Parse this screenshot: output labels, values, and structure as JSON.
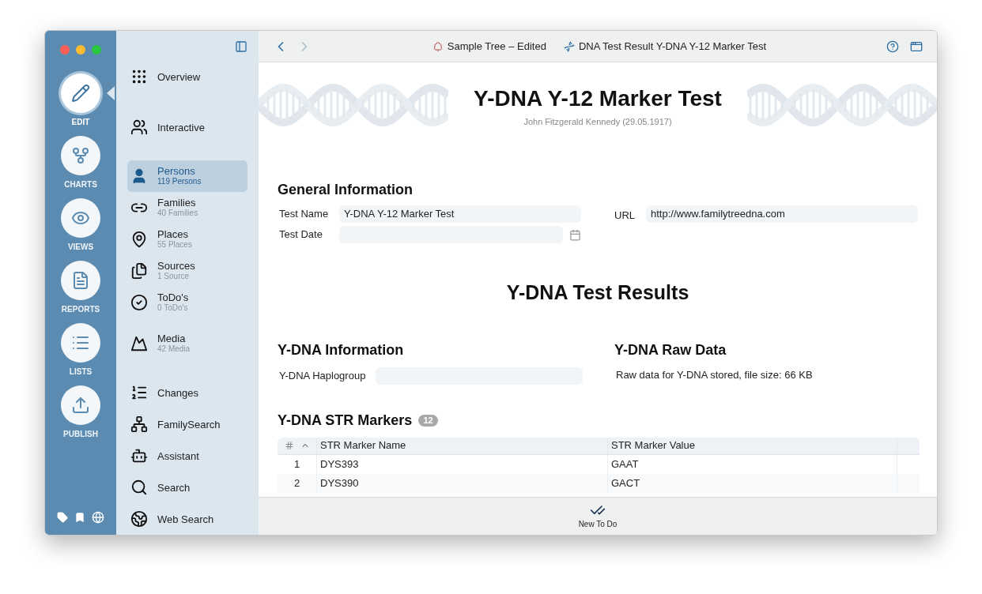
{
  "rail": {
    "items": [
      {
        "label": "EDIT",
        "selected": true
      },
      {
        "label": "CHARTS",
        "selected": false
      },
      {
        "label": "VIEWS",
        "selected": false
      },
      {
        "label": "REPORTS",
        "selected": false
      },
      {
        "label": "LISTS",
        "selected": false
      },
      {
        "label": "PUBLISH",
        "selected": false
      }
    ]
  },
  "sidebar": {
    "groups": [
      {
        "items": [
          {
            "label": "Overview",
            "selected": false
          }
        ]
      },
      {
        "items": [
          {
            "label": "Interactive",
            "selected": false
          }
        ]
      },
      {
        "items": [
          {
            "label": "Persons",
            "count": "119 Persons",
            "selected": true
          },
          {
            "label": "Families",
            "count": "40 Families",
            "selected": false
          },
          {
            "label": "Places",
            "count": "55 Places",
            "selected": false
          },
          {
            "label": "Sources",
            "count": "1 Source",
            "selected": false
          },
          {
            "label": "ToDo's",
            "count": "0 ToDo's",
            "selected": false
          }
        ]
      },
      {
        "items": [
          {
            "label": "Media",
            "count": "42 Media",
            "selected": false
          }
        ]
      },
      {
        "items": [
          {
            "label": "Changes",
            "selected": false
          },
          {
            "label": "FamilySearch",
            "selected": false
          },
          {
            "label": "Assistant",
            "selected": false
          },
          {
            "label": "Search",
            "selected": false
          },
          {
            "label": "Web Search",
            "selected": false
          }
        ]
      }
    ]
  },
  "titlebar": {
    "document": "Sample Tree – Edited",
    "tab": "DNA Test Result Y-DNA Y-12 Marker Test"
  },
  "header": {
    "title": "Y-DNA Y-12 Marker Test",
    "subtitle": "John Fitzgerald Kennedy (29.05.1917)"
  },
  "general": {
    "heading": "General Information",
    "test_name": {
      "label": "Test Name",
      "value": "Y-DNA Y-12 Marker Test"
    },
    "url": {
      "label": "URL",
      "value": "http://www.familytreedna.com"
    },
    "test_date": {
      "label": "Test Date"
    }
  },
  "results_title": "Y-DNA Test Results",
  "info": {
    "heading": "Y-DNA Information",
    "haplogroup": {
      "label": "Y-DNA Haplogroup"
    }
  },
  "raw": {
    "heading": "Y-DNA Raw Data",
    "text": "Raw data for Y-DNA stored, file size: 66 KB"
  },
  "markers": {
    "heading": "Y-DNA STR Markers",
    "count": "12",
    "columns": [
      "",
      "STR Marker Name",
      "STR Marker Value"
    ],
    "rows": [
      [
        "1",
        "DYS393",
        "GAAT"
      ],
      [
        "2",
        "DYS390",
        "GACT"
      ]
    ]
  },
  "bottom_bar": {
    "button": "New To Do"
  }
}
